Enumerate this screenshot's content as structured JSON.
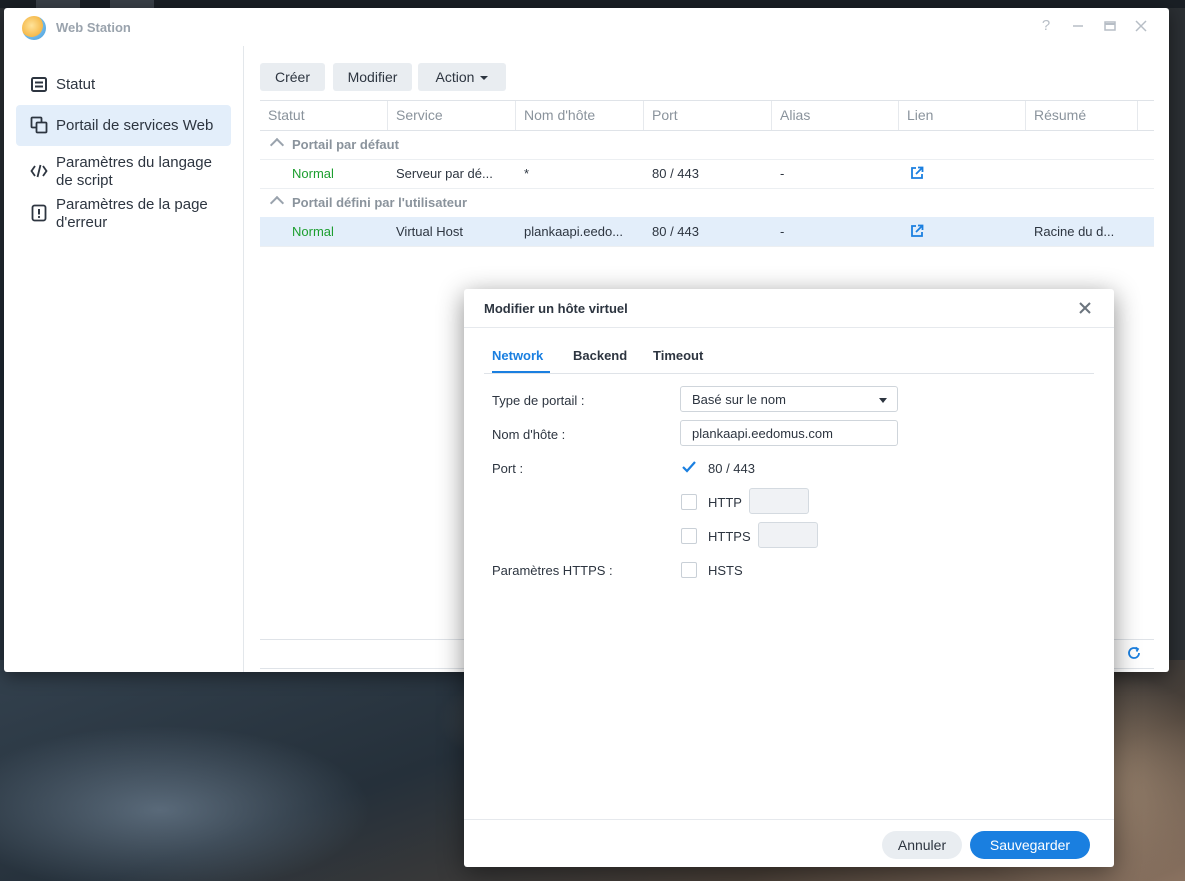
{
  "app": {
    "title": "Web Station",
    "help_icon": "help-icon",
    "minimize_icon": "minimize-icon",
    "maximize_icon": "maximize-icon",
    "close_icon": "close-icon"
  },
  "sidebar": {
    "items": [
      {
        "label": "Statut",
        "icon": "status-icon",
        "active": false
      },
      {
        "label": "Portail de services Web",
        "icon": "web-portal-icon",
        "active": true
      },
      {
        "label_line1": "Paramètres du langage",
        "label_line2": "de script",
        "icon": "code-icon",
        "active": false
      },
      {
        "label_line1": "Paramètres de la page",
        "label_line2": "d'erreur",
        "icon": "error-page-icon",
        "active": false
      }
    ]
  },
  "toolbar": {
    "create_label": "Créer",
    "edit_label": "Modifier",
    "action_label": "Action"
  },
  "grid": {
    "columns": [
      "Statut",
      "Service",
      "Nom d'hôte",
      "Port",
      "Alias",
      "Lien",
      "Résumé"
    ],
    "groups": [
      {
        "label": "Portail par défaut",
        "rows": [
          {
            "status": "Normal",
            "service": "Serveur par dé...",
            "hostname": "*",
            "port": "80 / 443",
            "alias": "-",
            "summary": ""
          }
        ]
      },
      {
        "label": "Portail défini par l'utilisateur",
        "rows": [
          {
            "status": "Normal",
            "service": "Virtual Host",
            "hostname": "plankaapi.eedo...",
            "port": "80 / 443",
            "alias": "-",
            "summary": "Racine du d..."
          }
        ]
      }
    ]
  },
  "modal": {
    "title": "Modifier un hôte virtuel",
    "tabs": [
      "Network",
      "Backend",
      "Timeout"
    ],
    "active_tab": "Network",
    "form": {
      "portal_type_label": "Type de portail :",
      "portal_type_value": "Basé sur le nom",
      "hostname_label": "Nom d'hôte :",
      "hostname_value": "plankaapi.eedomus.com",
      "port_label": "Port :",
      "port_default_label": "80 / 443",
      "port_default_checked": true,
      "http_label": "HTTP",
      "http_checked": false,
      "http_value": "",
      "https_label": "HTTPS",
      "https_checked": false,
      "https_value": "",
      "https_settings_label": "Paramètres HTTPS :",
      "hsts_label": "HSTS",
      "hsts_checked": false
    },
    "cancel_label": "Annuler",
    "save_label": "Sauvegarder"
  },
  "colors": {
    "accent": "#1a7fe0",
    "status_normal": "#1c9e2f",
    "selected_row": "#e3eefa"
  }
}
